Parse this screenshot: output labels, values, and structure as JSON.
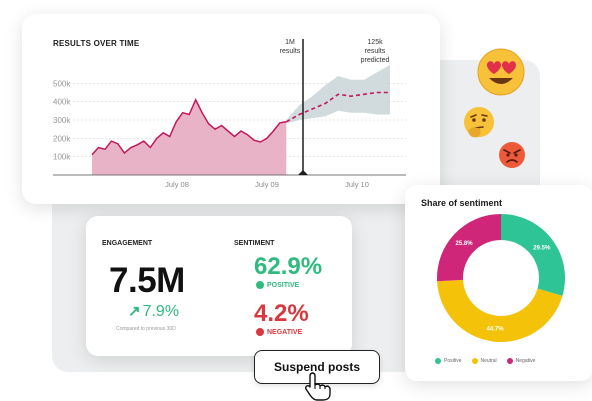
{
  "results_chart": {
    "title": "RESULTS OVER TIME",
    "y_ticks": [
      "500k",
      "400k",
      "300k",
      "200k",
      "100k"
    ],
    "x_ticks": [
      "July 08",
      "July 09",
      "July 10"
    ],
    "annotation_now_value": "1M",
    "annotation_now_unit": "results",
    "annotation_pred_value": "125k",
    "annotation_pred_line1": "results",
    "annotation_pred_line2": "predicted"
  },
  "chart_data": {
    "type": "area",
    "title": "RESULTS OVER TIME",
    "x_ticks": [
      "July 08",
      "July 09",
      "July 10"
    ],
    "ylim": [
      0,
      600000
    ],
    "y_ticks": [
      100000,
      200000,
      300000,
      400000,
      500000
    ],
    "series": [
      {
        "name": "results",
        "points": [
          [
            0,
            110000
          ],
          [
            1,
            150000
          ],
          [
            2,
            140000
          ],
          [
            3,
            185000
          ],
          [
            4,
            170000
          ],
          [
            5,
            120000
          ],
          [
            6,
            150000
          ],
          [
            7,
            165000
          ],
          [
            8,
            185000
          ],
          [
            9,
            150000
          ],
          [
            10,
            200000
          ],
          [
            11,
            230000
          ],
          [
            12,
            210000
          ],
          [
            13,
            290000
          ],
          [
            14,
            340000
          ],
          [
            15,
            330000
          ],
          [
            16,
            410000
          ],
          [
            17,
            340000
          ],
          [
            18,
            280000
          ],
          [
            19,
            250000
          ],
          [
            20,
            270000
          ],
          [
            21,
            240000
          ],
          [
            22,
            210000
          ],
          [
            23,
            240000
          ],
          [
            24,
            220000
          ],
          [
            25,
            190000
          ],
          [
            26,
            180000
          ],
          [
            27,
            200000
          ],
          [
            28,
            240000
          ],
          [
            29,
            285000
          ],
          [
            30,
            290000
          ]
        ]
      },
      {
        "name": "predicted",
        "points": [
          [
            30,
            290000
          ],
          [
            32,
            330000
          ],
          [
            34,
            360000
          ],
          [
            36,
            390000
          ],
          [
            38,
            440000
          ],
          [
            40,
            430000
          ],
          [
            42,
            440000
          ],
          [
            44,
            450000
          ],
          [
            46,
            450000
          ]
        ],
        "band_upper": [
          300000,
          380000,
          430000,
          490000,
          540000,
          520000,
          520000,
          560000,
          600000
        ],
        "band_lower": [
          280000,
          300000,
          310000,
          320000,
          350000,
          340000,
          340000,
          330000,
          330000
        ]
      }
    ],
    "colors": {
      "fill": "#e9b3c7",
      "line": "#c2185b",
      "band": "#c9d4d6"
    }
  },
  "engagement": {
    "label": "ENGAGEMENT",
    "value": "7.5M",
    "delta": "7.9%",
    "compare": "Compared to previous 30D"
  },
  "sentiment": {
    "label": "SENTIMENT",
    "positive_value": "62.9%",
    "positive_label": "POSITIVE",
    "negative_value": "4.2%",
    "negative_label": "NEGATIVE"
  },
  "share": {
    "title": "Share of sentiment",
    "legend": [
      {
        "label": "Positive",
        "color": "#2fc495"
      },
      {
        "label": "Neutral",
        "color": "#f5c20a"
      },
      {
        "label": "Negative",
        "color": "#d0267a"
      }
    ]
  },
  "donut_data": {
    "type": "pie",
    "slices": [
      {
        "name": "Positive",
        "value": 29.5,
        "label": "29.5%",
        "color": "#2fc495"
      },
      {
        "name": "Neutral",
        "value": 44.7,
        "label": "44.7%",
        "color": "#f5c20a"
      },
      {
        "name": "Negative",
        "value": 25.8,
        "label": "25.8%",
        "color": "#d0267a"
      }
    ]
  },
  "actions": {
    "suspend_label": "Suspend posts"
  },
  "emojis": [
    "heart-eyes-face",
    "thinking-face",
    "angry-face"
  ],
  "colors": {
    "positive": "#2fba7e",
    "negative": "#d9383f",
    "accent_pink": "#c2185b"
  }
}
